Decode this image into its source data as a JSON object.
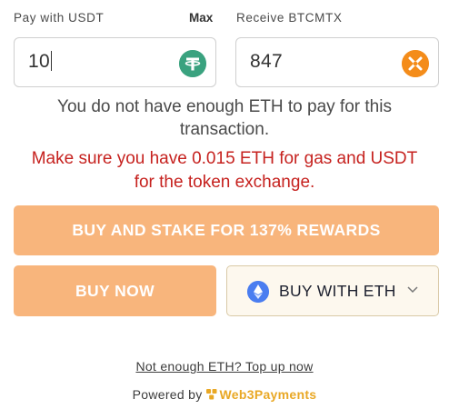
{
  "labels": {
    "pay": "Pay with USDT",
    "max": "Max",
    "receive": "Receive BTCMTX"
  },
  "pay_field": {
    "value": "10",
    "icon": "usdt-icon",
    "icon_color": "#3aa27f"
  },
  "receive_field": {
    "value": "847",
    "icon": "btcmtx-icon",
    "icon_color": "#f48c1a"
  },
  "messages": {
    "eth_line1": "You do not have enough ETH to pay for this",
    "eth_line2": "transaction.",
    "gas_line1": "Make sure you have 0.015 ETH for gas and USDT",
    "gas_line2": "for the token exchange.",
    "gas_color": "#c6221f"
  },
  "buttons": {
    "stake": "BUY AND STAKE FOR 137% REWARDS",
    "buy_now": "BUY NOW",
    "buy_with_eth": "BUY WITH ETH",
    "accent_color": "#f8b57c"
  },
  "footer": {
    "topup": "Not enough ETH? Top up now",
    "powered_by": "Powered by",
    "brand": "Web3Payments",
    "brand_color": "#e9a825"
  }
}
